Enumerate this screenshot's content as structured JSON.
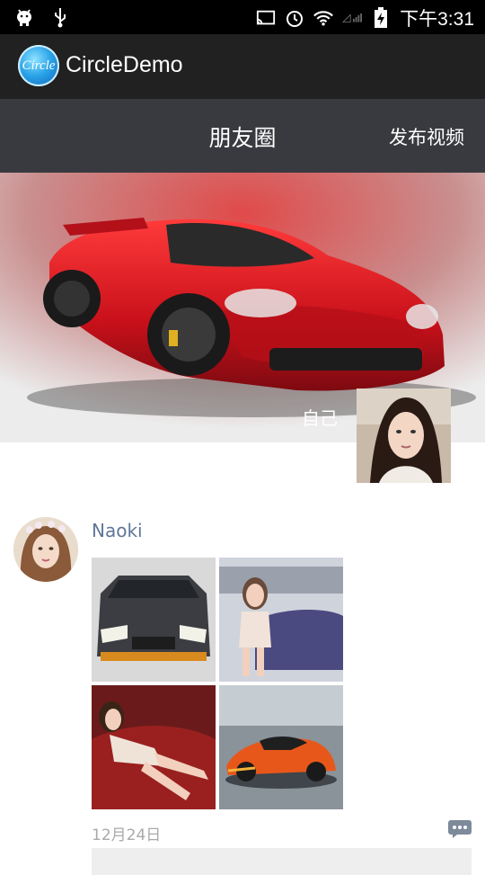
{
  "status_bar": {
    "time": "下午3:31"
  },
  "app_bar": {
    "logo_text": "Circle",
    "title": "CircleDemo"
  },
  "title_bar": {
    "title": "朋友圈",
    "action": "发布视频"
  },
  "cover": {
    "user_name": "自己"
  },
  "post": {
    "author": "Naoki",
    "date": "12月24日"
  },
  "colors": {
    "name_link": "#5f7799",
    "title_bar": "#393a3f",
    "action_bar": "#212121"
  }
}
